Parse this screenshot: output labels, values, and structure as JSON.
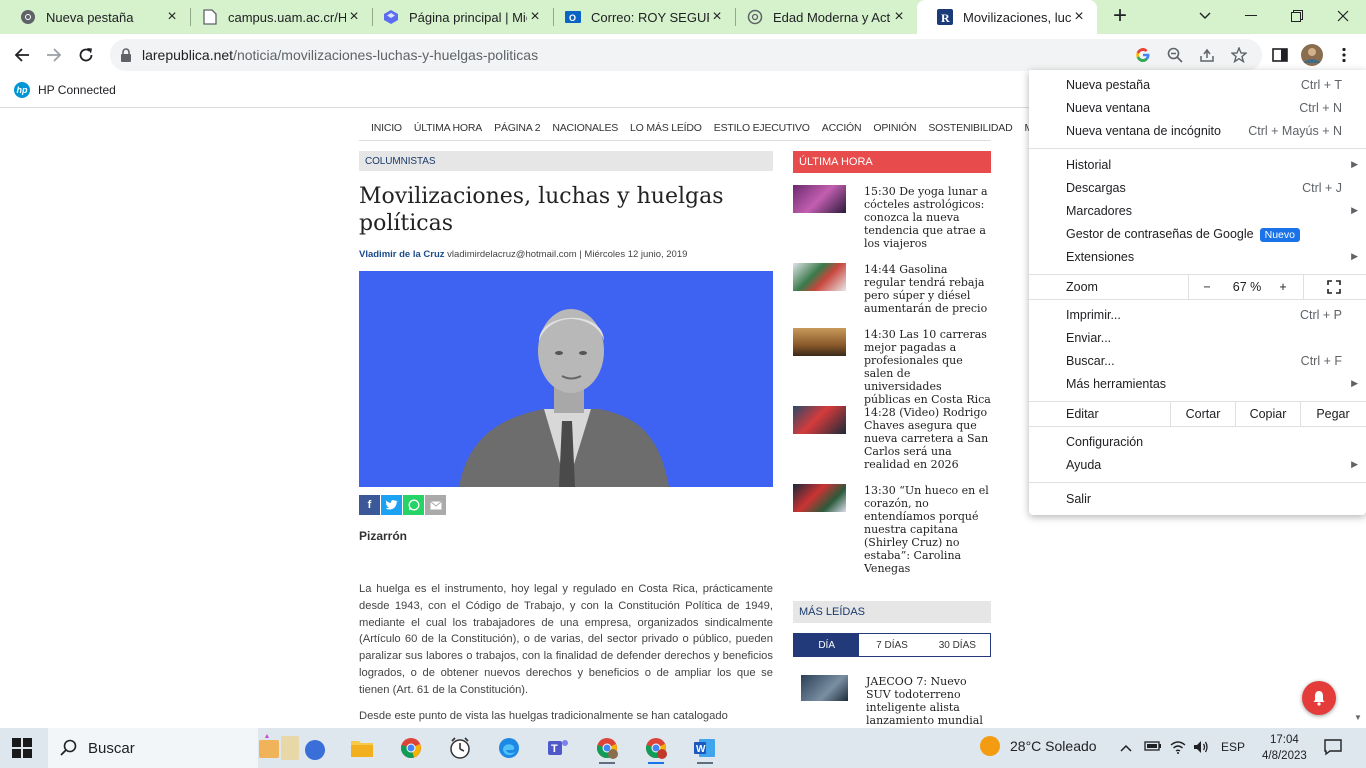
{
  "tabs": [
    {
      "title": "Nueva pestaña",
      "icon": "chrome-icon"
    },
    {
      "title": "campus.uam.ac.cr/Ho",
      "icon": "document-icon"
    },
    {
      "title": "Página principal | Mic",
      "icon": "microsoft-icon"
    },
    {
      "title": "Correo: ROY SEGURA",
      "icon": "outlook-icon"
    },
    {
      "title": "Edad Moderna y Actu",
      "icon": "chatgpt-icon"
    },
    {
      "title": "Movilizaciones, luchas",
      "icon": "larepublica-icon"
    }
  ],
  "url": {
    "host": "larepublica.net",
    "path": "/noticia/movilizaciones-luchas-y-huelgas-politicas"
  },
  "bookmarks": [
    {
      "label": "HP Connected"
    }
  ],
  "site_nav": [
    "INICIO",
    "ÚLTIMA HORA",
    "PÁGINA 2",
    "NACIONALES",
    "LO MÁS LEÍDO",
    "ESTILO EJECUTIVO",
    "ACCIÓN",
    "OPINIÓN",
    "SOSTENIBILIDAD",
    "MÁS"
  ],
  "article": {
    "category": "COLUMNISTAS",
    "headline": "Movilizaciones, luchas y huelgas políticas",
    "author": "Vladimir de la Cruz",
    "email": "vladimirdelacruz@hotmail.com",
    "date": "| Miércoles 12 junio, 2019",
    "section": "Pizarrón",
    "para1": "La huelga es el instrumento, hoy legal y regulado en Costa Rica, prácticamente desde 1943, con el Código de Trabajo, y con la Constitución Política de 1949, mediante el cual los trabajadores de una empresa, organizados sindicalmente (Artículo 60 de la Constitución), o de varias, del sector privado o público, pueden paralizar sus labores o trabajos, con la finalidad de defender derechos y beneficios logrados, o de obtener nuevos derechos y beneficios o de ampliar los que se tienen (Art. 61 de la Constitución).",
    "para2": "Desde este punto de vista las huelgas tradicionalmente se han catalogado"
  },
  "ultima_hora": {
    "title": "ÚLTIMA HORA",
    "items": [
      {
        "time": "15:30",
        "text": "De yoga lunar a cócteles astrológicos: conozca la nueva tendencia que atrae a los viajeros"
      },
      {
        "time": "14:44",
        "text": "Gasolina regular tendrá rebaja pero súper y diésel aumentarán de precio"
      },
      {
        "time": "14:30",
        "text": "Las 10 carreras mejor pagadas a profesionales que salen de universidades públicas en Costa Rica"
      },
      {
        "time": "14:28",
        "text": "(Video) Rodrigo Chaves asegura que nueva carretera a San Carlos será una realidad en 2026"
      },
      {
        "time": "13:30",
        "text": "“Un hueco en el corazón, no entendíamos porqué nuestra capitana (Shirley Cruz) no estaba”: Carolina Venegas"
      }
    ]
  },
  "mas_leidas": {
    "title": "MÁS LEÍDAS",
    "tabs": [
      "DÍA",
      "7 DÍAS",
      "30 DÍAS"
    ],
    "item": "JAECOO 7: Nuevo SUV todoterreno inteligente alista lanzamiento mundial"
  },
  "menu": {
    "new_tab": "Nueva pestaña",
    "new_tab_sc": "Ctrl + T",
    "new_window": "Nueva ventana",
    "new_window_sc": "Ctrl + N",
    "incognito": "Nueva ventana de incógnito",
    "incognito_sc": "Ctrl + Mayús + N",
    "history": "Historial",
    "downloads": "Descargas",
    "downloads_sc": "Ctrl + J",
    "bookmarks": "Marcadores",
    "passwords": "Gestor de contraseñas de Google",
    "passwords_badge": "Nuevo",
    "extensions": "Extensiones",
    "zoom": "Zoom",
    "zoom_minus": "−",
    "zoom_value": "67 %",
    "zoom_plus": "+",
    "print": "Imprimir...",
    "print_sc": "Ctrl + P",
    "send": "Enviar...",
    "find": "Buscar...",
    "find_sc": "Ctrl + F",
    "more_tools": "Más herramientas",
    "edit": "Editar",
    "cut": "Cortar",
    "copy": "Copiar",
    "paste": "Pegar",
    "settings": "Configuración",
    "help": "Ayuda",
    "exit": "Salir"
  },
  "taskbar": {
    "search": "Buscar",
    "weather": "28°C  Soleado",
    "lang": "ESP",
    "time": "17:04",
    "date": "4/8/2023"
  },
  "colors": {
    "tabstrip": "#d6f2cc",
    "hero": "#3e63f2",
    "ultima_hora": "#e84b4b",
    "mas_leidas_tab": "#223a7a",
    "accent": "#1a73e8"
  }
}
